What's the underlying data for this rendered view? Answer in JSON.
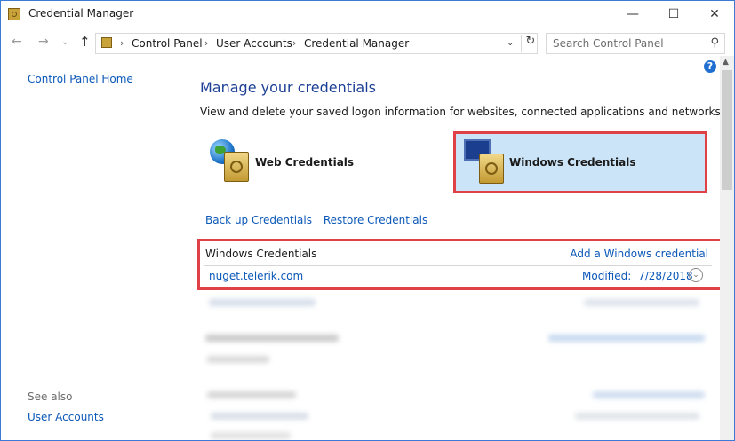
{
  "window": {
    "title": "Credential Manager"
  },
  "titlebar": {
    "minimize": "—",
    "maximize": "☐",
    "close": "✕"
  },
  "address": {
    "breadcrumbs": [
      "Control Panel",
      "User Accounts",
      "Credential Manager"
    ],
    "search_placeholder": "Search Control Panel"
  },
  "sidebar": {
    "home_link": "Control Panel Home",
    "see_also": "See also",
    "links": [
      "User Accounts"
    ]
  },
  "main": {
    "title": "Manage your credentials",
    "subtitle": "View and delete your saved logon information for websites, connected applications and networks.",
    "tiles": [
      {
        "label": "Web Credentials",
        "selected": false
      },
      {
        "label": "Windows Credentials",
        "selected": true
      }
    ],
    "actions": [
      "Back up Credentials",
      "Restore Credentials"
    ],
    "section": {
      "title": "Windows Credentials",
      "add_link": "Add a Windows credential",
      "entries": [
        {
          "name": "nuget.telerik.com",
          "modified_label": "Modified:",
          "modified_date": "7/28/2018"
        }
      ]
    }
  },
  "colors": {
    "link": "#0b58b8",
    "title": "#1c3f95",
    "highlight": "#e04147",
    "selected_tile": "#cce4f7"
  }
}
